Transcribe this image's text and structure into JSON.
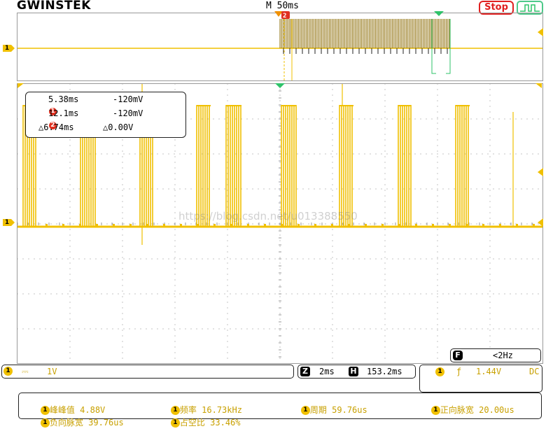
{
  "header": {
    "logo": "GWINSTEK",
    "timebase": "M 50ms",
    "run_state": "Stop"
  },
  "channel": {
    "id": "1",
    "scale": "1V",
    "coupling_symbol": "⎓"
  },
  "cursors": {
    "c1_badge": "1",
    "c1_time": "5.38ms",
    "c1_volt": "-120mV",
    "c2_badge": "2",
    "c2_time": "12.1ms",
    "c2_volt": "-120mV",
    "delta_time": "△6.74ms",
    "delta_volt": "△0.00V"
  },
  "trigger_freq": {
    "label": "F",
    "value": "<2Hz"
  },
  "zoom": {
    "z_label": "Z",
    "z_scale": "2ms",
    "h_label": "H",
    "h_pos": "153.2ms"
  },
  "trigger": {
    "slope_symbol": "ƒ",
    "level": "1.44V",
    "coupling": "DC"
  },
  "measurements": [
    {
      "label": "峰峰值",
      "value": "4.88V"
    },
    {
      "label": "频率",
      "value": "16.73kHz"
    },
    {
      "label": "周期",
      "value": "59.76us"
    },
    {
      "label": "正向脉宽",
      "value": "20.00us"
    },
    {
      "label": "负向脉宽",
      "value": "39.76us"
    },
    {
      "label": "占空比",
      "value": "33.46%"
    }
  ],
  "watermark": "https://blog.csdn.net/u013388550",
  "colors": {
    "trace": "#f0c000",
    "stop": "#e02020",
    "trigger": "#2fc36a"
  }
}
